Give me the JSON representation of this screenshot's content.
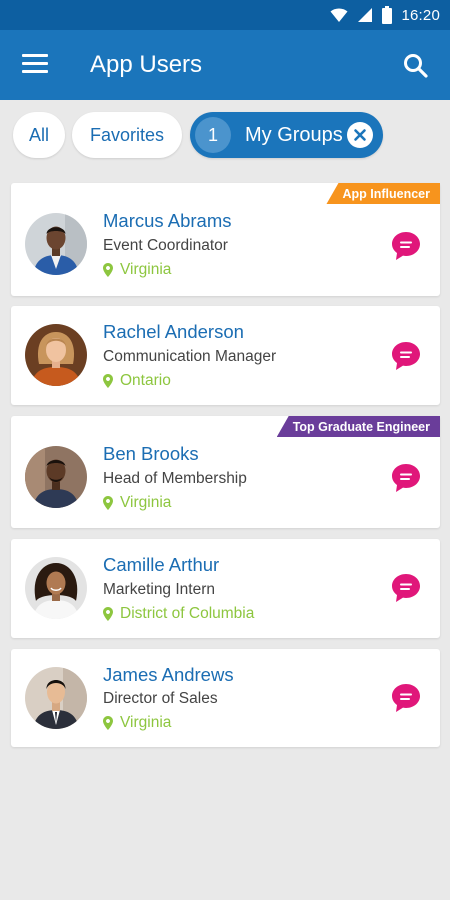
{
  "status_bar": {
    "time": "16:20"
  },
  "app_bar": {
    "title": "App Users"
  },
  "filters": {
    "all": "All",
    "favorites": "Favorites",
    "groups_count": "1",
    "groups_label": "My Groups"
  },
  "users": [
    {
      "name": "Marcus Abrams",
      "role": "Event Coordinator",
      "location": "Virginia",
      "badge": "App Influencer"
    },
    {
      "name": "Rachel Anderson",
      "role": "Communication Manager",
      "location": "Ontario",
      "badge": ""
    },
    {
      "name": "Ben Brooks",
      "role": "Head of Membership",
      "location": "Virginia",
      "badge": "Top Graduate Engineer"
    },
    {
      "name": "Camille Arthur",
      "role": "Marketing Intern",
      "location": "District of Columbia",
      "badge": ""
    },
    {
      "name": "James Andrews",
      "role": "Director of Sales",
      "location": "Virginia",
      "badge": ""
    }
  ],
  "colors": {
    "primary": "#1b75bb",
    "status_bar": "#0d5fa1",
    "link": "#1b6db3",
    "location": "#8dc63f",
    "chat": "#e0177a",
    "badge_orange": "#f7941d",
    "badge_purple": "#6a3d9a"
  },
  "icons": [
    "menu-icon",
    "search-icon",
    "close-icon",
    "map-pin-icon",
    "chat-bubble-icon",
    "wifi-icon",
    "signal-icon",
    "battery-icon"
  ]
}
